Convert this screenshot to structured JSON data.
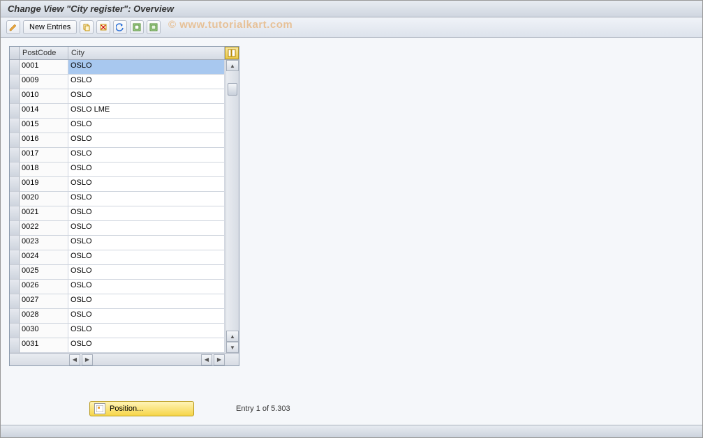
{
  "title": "Change View \"City register\": Overview",
  "watermark": "© www.tutorialkart.com",
  "toolbar": {
    "new_entries": "New Entries"
  },
  "table": {
    "columns": {
      "postcode": "PostCode",
      "city": "City"
    },
    "rows": [
      {
        "postcode": "0001",
        "city": "OSLO",
        "selected": true
      },
      {
        "postcode": "0009",
        "city": "OSLO"
      },
      {
        "postcode": "0010",
        "city": "OSLO"
      },
      {
        "postcode": "0014",
        "city": "OSLO LME"
      },
      {
        "postcode": "0015",
        "city": "OSLO"
      },
      {
        "postcode": "0016",
        "city": "OSLO"
      },
      {
        "postcode": "0017",
        "city": "OSLO"
      },
      {
        "postcode": "0018",
        "city": "OSLO"
      },
      {
        "postcode": "0019",
        "city": "OSLO"
      },
      {
        "postcode": "0020",
        "city": "OSLO"
      },
      {
        "postcode": "0021",
        "city": "OSLO"
      },
      {
        "postcode": "0022",
        "city": "OSLO"
      },
      {
        "postcode": "0023",
        "city": "OSLO"
      },
      {
        "postcode": "0024",
        "city": "OSLO"
      },
      {
        "postcode": "0025",
        "city": "OSLO"
      },
      {
        "postcode": "0026",
        "city": "OSLO"
      },
      {
        "postcode": "0027",
        "city": "OSLO"
      },
      {
        "postcode": "0028",
        "city": "OSLO"
      },
      {
        "postcode": "0030",
        "city": "OSLO"
      },
      {
        "postcode": "0031",
        "city": "OSLO"
      }
    ]
  },
  "position_button": "Position...",
  "entry_info": "Entry 1 of 5.303"
}
